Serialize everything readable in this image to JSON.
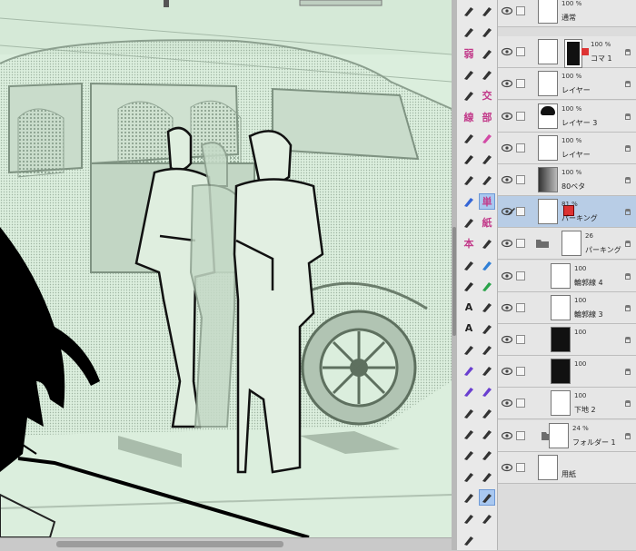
{
  "tool_palette": {
    "items": [
      {
        "id": "select",
        "icon": "marquee-icon",
        "label": ""
      },
      {
        "id": "lasso",
        "icon": "sparkle-icon",
        "label": ""
      },
      {
        "id": "wand",
        "icon": "magic-wand-icon",
        "label": ""
      },
      {
        "id": "move",
        "icon": "move-icon",
        "label": ""
      },
      {
        "id": "g1",
        "icon": "kanji-tool-icon",
        "label": "弱"
      },
      {
        "id": "g2",
        "icon": "pen-icon",
        "label": ""
      },
      {
        "id": "circle",
        "icon": "circle-icon",
        "label": ""
      },
      {
        "id": "pen2",
        "icon": "pen-icon",
        "label": ""
      },
      {
        "id": "pen3",
        "icon": "pencil-icon",
        "label": ""
      },
      {
        "id": "k1",
        "icon": "kanji-tool-icon",
        "label": "交"
      },
      {
        "id": "k2",
        "icon": "kanji-tool-icon",
        "label": "線"
      },
      {
        "id": "k3",
        "icon": "kanji-tool-icon",
        "label": "部"
      },
      {
        "id": "k4",
        "icon": "brush-icon",
        "label": ""
      },
      {
        "id": "k5",
        "icon": "pink-brush-icon",
        "label": ""
      },
      {
        "id": "k6",
        "icon": "fill-icon",
        "label": ""
      },
      {
        "id": "k7",
        "icon": "brush-icon",
        "label": ""
      },
      {
        "id": "k8",
        "icon": "eraser-icon",
        "label": ""
      },
      {
        "id": "k9",
        "icon": "brush-icon",
        "label": ""
      },
      {
        "id": "k10",
        "icon": "blue-brush-icon",
        "label": ""
      },
      {
        "id": "k11",
        "icon": "kanji-tool-icon",
        "label": "単"
      },
      {
        "id": "k12",
        "icon": "pen-icon",
        "label": ""
      },
      {
        "id": "k13",
        "icon": "kanji-tool-icon",
        "label": "紙"
      },
      {
        "id": "k14",
        "icon": "kanji-tool-icon",
        "label": "本"
      },
      {
        "id": "k15",
        "icon": "texture-icon",
        "label": ""
      },
      {
        "id": "k16",
        "icon": "pen-icon",
        "label": ""
      },
      {
        "id": "k17",
        "icon": "blue-tool-icon",
        "label": ""
      },
      {
        "id": "k18",
        "icon": "fill-icon",
        "label": ""
      },
      {
        "id": "k19",
        "icon": "green-tool-icon",
        "label": ""
      },
      {
        "id": "text",
        "icon": "text-icon",
        "label": "A"
      },
      {
        "id": "balloon",
        "icon": "balloon-icon",
        "label": ""
      },
      {
        "id": "text2",
        "icon": "text-icon",
        "label": "A"
      },
      {
        "id": "balloon2",
        "icon": "balloon-icon",
        "label": ""
      },
      {
        "id": "grad1",
        "icon": "gradient-icon",
        "label": ""
      },
      {
        "id": "grad2",
        "icon": "gradient-icon",
        "label": ""
      },
      {
        "id": "g3",
        "icon": "color-icon",
        "label": ""
      },
      {
        "id": "g4",
        "icon": "spiral-icon",
        "label": ""
      },
      {
        "id": "g5",
        "icon": "color-icon",
        "label": ""
      },
      {
        "id": "g6",
        "icon": "color-icon",
        "label": ""
      },
      {
        "id": "frame",
        "icon": "frame-icon",
        "label": ""
      },
      {
        "id": "frame2",
        "icon": "frame-icon",
        "label": ""
      },
      {
        "id": "ruler",
        "icon": "ruler-icon",
        "label": ""
      },
      {
        "id": "ruler2",
        "icon": "ruler-icon",
        "label": ""
      },
      {
        "id": "r3",
        "icon": "grid-icon",
        "label": ""
      },
      {
        "id": "r4",
        "icon": "grid-icon",
        "label": ""
      },
      {
        "id": "r5",
        "icon": "grid-icon",
        "label": ""
      },
      {
        "id": "r6",
        "icon": "grid-icon",
        "label": ""
      },
      {
        "id": "eyedrop",
        "icon": "eyedropper-icon",
        "label": ""
      },
      {
        "id": "hand",
        "icon": "hand-icon",
        "label": ""
      },
      {
        "id": "zoom",
        "icon": "zoom-icon",
        "label": ""
      },
      {
        "id": "obj",
        "icon": "object-icon",
        "label": ""
      },
      {
        "id": "move2",
        "icon": "move-icon",
        "label": ""
      }
    ]
  },
  "layers": [
    {
      "pct": "100 %",
      "name": "通常",
      "kind": "top"
    },
    {
      "pct": "100 %",
      "name": "コマ 1",
      "kind": "frame"
    },
    {
      "pct": "100 %",
      "name": "レイヤー",
      "kind": "plain"
    },
    {
      "pct": "100 %",
      "name": "レイヤー 3",
      "kind": "hair"
    },
    {
      "pct": "100 %",
      "name": "レイヤー",
      "kind": "plain"
    },
    {
      "pct": "100 %",
      "name": "80ベタ",
      "kind": "gray"
    },
    {
      "pct": "81 %",
      "name": "パーキング",
      "kind": "selected"
    },
    {
      "pct": "26",
      "name": "パーキング",
      "kind": "folder"
    },
    {
      "pct": "100",
      "name": "輪郭線 4",
      "kind": "sub"
    },
    {
      "pct": "100",
      "name": "輪郭線 3",
      "kind": "sub"
    },
    {
      "pct": "100",
      "name": "",
      "kind": "dark"
    },
    {
      "pct": "100",
      "name": "",
      "kind": "dark"
    },
    {
      "pct": "100",
      "name": "下地 2",
      "kind": "sub"
    },
    {
      "pct": "24 %",
      "name": "フォルダー 1",
      "kind": "folder2"
    },
    {
      "pct": "",
      "name": "用紙",
      "kind": "paper"
    }
  ],
  "colors": {
    "canvas": "#dbeedd",
    "selected_row": "#b8cde6",
    "panel": "#e6e6e6"
  }
}
